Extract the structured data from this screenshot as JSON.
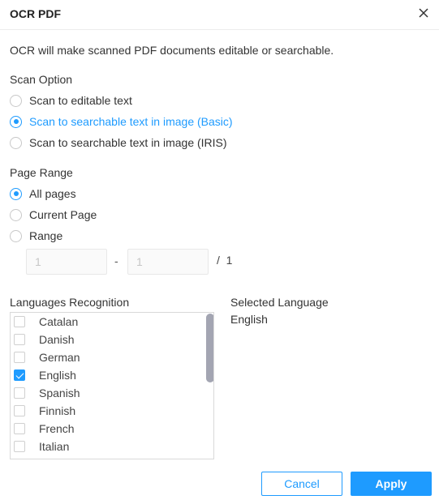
{
  "dialog": {
    "title": "OCR PDF",
    "close_icon": "close-icon",
    "description": "OCR will make scanned PDF documents editable or searchable."
  },
  "scan_option": {
    "label": "Scan Option",
    "options": [
      {
        "label": "Scan to editable text",
        "selected": false
      },
      {
        "label": "Scan to searchable text in image (Basic)",
        "selected": true
      },
      {
        "label": "Scan to searchable text in image (IRIS)",
        "selected": false
      }
    ]
  },
  "page_range": {
    "label": "Page Range",
    "options": [
      {
        "label": "All pages",
        "selected": true
      },
      {
        "label": "Current Page",
        "selected": false
      },
      {
        "label": "Range",
        "selected": false
      }
    ],
    "from_value": "1",
    "to_value": "1",
    "separator": "-",
    "total": "/  1"
  },
  "languages": {
    "label": "Languages Recognition",
    "items": [
      {
        "label": "Catalan",
        "checked": false
      },
      {
        "label": "Danish",
        "checked": false
      },
      {
        "label": "German",
        "checked": false
      },
      {
        "label": "English",
        "checked": true
      },
      {
        "label": "Spanish",
        "checked": false
      },
      {
        "label": "Finnish",
        "checked": false
      },
      {
        "label": "French",
        "checked": false
      },
      {
        "label": "Italian",
        "checked": false
      },
      {
        "label": "",
        "checked": false
      }
    ]
  },
  "selected_language": {
    "label": "Selected Language",
    "value": "English"
  },
  "buttons": {
    "cancel": "Cancel",
    "apply": "Apply"
  },
  "colors": {
    "accent": "#1e9bff",
    "scrollbar": "#a3a5b2"
  }
}
